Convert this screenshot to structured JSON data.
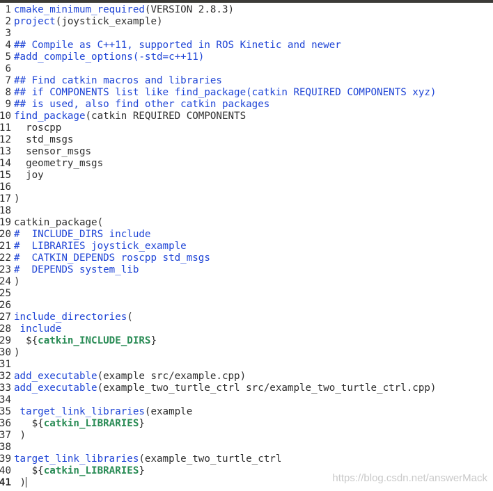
{
  "editor": {
    "watermark": "https://blog.csdn.net/answerMack",
    "colors": {
      "keyword": "#1f45d6",
      "comment": "#1f45d6",
      "variable": "#2a8c56",
      "text": "#2e2e2e",
      "background": "#ffffff"
    },
    "lines": [
      {
        "n": "1",
        "segs": [
          {
            "t": "cmake_minimum_required",
            "c": "kw"
          },
          {
            "t": "(VERSION 2.8.3)",
            "c": ""
          }
        ]
      },
      {
        "n": "2",
        "segs": [
          {
            "t": "project",
            "c": "kw"
          },
          {
            "t": "(joystick_example)",
            "c": ""
          }
        ]
      },
      {
        "n": "3",
        "segs": []
      },
      {
        "n": "4",
        "segs": [
          {
            "t": "## Compile as C++11, supported in ROS Kinetic and newer",
            "c": "cm"
          }
        ]
      },
      {
        "n": "5",
        "segs": [
          {
            "t": "#add_compile_options(-std=c++11)",
            "c": "cm"
          }
        ]
      },
      {
        "n": "6",
        "segs": []
      },
      {
        "n": "7",
        "segs": [
          {
            "t": "## Find catkin macros and libraries",
            "c": "cm"
          }
        ]
      },
      {
        "n": "8",
        "segs": [
          {
            "t": "## if COMPONENTS list like find_package(catkin REQUIRED COMPONENTS xyz)",
            "c": "cm"
          }
        ]
      },
      {
        "n": "9",
        "segs": [
          {
            "t": "## is used, also find other catkin packages",
            "c": "cm"
          }
        ]
      },
      {
        "n": "10",
        "segs": [
          {
            "t": "find_package",
            "c": "kw"
          },
          {
            "t": "(catkin REQUIRED COMPONENTS",
            "c": ""
          }
        ]
      },
      {
        "n": "11",
        "segs": [
          {
            "t": "  roscpp",
            "c": ""
          }
        ]
      },
      {
        "n": "12",
        "segs": [
          {
            "t": "  std_msgs",
            "c": ""
          }
        ]
      },
      {
        "n": "13",
        "segs": [
          {
            "t": "  sensor_msgs",
            "c": ""
          }
        ]
      },
      {
        "n": "14",
        "segs": [
          {
            "t": "  geometry_msgs",
            "c": ""
          }
        ]
      },
      {
        "n": "15",
        "segs": [
          {
            "t": "  joy",
            "c": ""
          }
        ]
      },
      {
        "n": "16",
        "segs": []
      },
      {
        "n": "17",
        "segs": [
          {
            "t": ")",
            "c": ""
          }
        ]
      },
      {
        "n": "18",
        "segs": []
      },
      {
        "n": "19",
        "segs": [
          {
            "t": "catkin_package(",
            "c": ""
          }
        ]
      },
      {
        "n": "20",
        "segs": [
          {
            "t": "#  INCLUDE_DIRS include",
            "c": "cm"
          }
        ]
      },
      {
        "n": "21",
        "segs": [
          {
            "t": "#  LIBRARIES joystick_example",
            "c": "cm"
          }
        ]
      },
      {
        "n": "22",
        "segs": [
          {
            "t": "#  CATKIN_DEPENDS roscpp std_msgs",
            "c": "cm"
          }
        ]
      },
      {
        "n": "23",
        "segs": [
          {
            "t": "#  DEPENDS system_lib",
            "c": "cm"
          }
        ]
      },
      {
        "n": "24",
        "segs": [
          {
            "t": ")",
            "c": ""
          }
        ]
      },
      {
        "n": "25",
        "segs": []
      },
      {
        "n": "26",
        "segs": []
      },
      {
        "n": "27",
        "segs": [
          {
            "t": "include_directories",
            "c": "kw"
          },
          {
            "t": "(",
            "c": ""
          }
        ]
      },
      {
        "n": "28",
        "segs": [
          {
            "t": " include",
            "c": "kw"
          }
        ]
      },
      {
        "n": "29",
        "segs": [
          {
            "t": "  ${",
            "c": ""
          },
          {
            "t": "catkin_INCLUDE_DIRS",
            "c": "vr"
          },
          {
            "t": "}",
            "c": ""
          }
        ]
      },
      {
        "n": "30",
        "segs": [
          {
            "t": ")",
            "c": ""
          }
        ]
      },
      {
        "n": "31",
        "segs": []
      },
      {
        "n": "32",
        "segs": [
          {
            "t": "add_executable",
            "c": "kw"
          },
          {
            "t": "(example src/example.cpp)",
            "c": ""
          }
        ]
      },
      {
        "n": "33",
        "segs": [
          {
            "t": "add_executable",
            "c": "kw"
          },
          {
            "t": "(example_two_turtle_ctrl src/example_two_turtle_ctrl.cpp)",
            "c": ""
          }
        ]
      },
      {
        "n": "34",
        "segs": []
      },
      {
        "n": "35",
        "segs": [
          {
            "t": " target_link_libraries",
            "c": "kw"
          },
          {
            "t": "(example",
            "c": ""
          }
        ]
      },
      {
        "n": "36",
        "segs": [
          {
            "t": "   ${",
            "c": ""
          },
          {
            "t": "catkin_LIBRARIES",
            "c": "vr"
          },
          {
            "t": "}",
            "c": ""
          }
        ]
      },
      {
        "n": "37",
        "segs": [
          {
            "t": " )",
            "c": ""
          }
        ]
      },
      {
        "n": "38",
        "segs": []
      },
      {
        "n": "39",
        "segs": [
          {
            "t": "target_link_libraries",
            "c": "kw"
          },
          {
            "t": "(example_two_turtle_ctrl",
            "c": ""
          }
        ]
      },
      {
        "n": "40",
        "segs": [
          {
            "t": "   ${",
            "c": ""
          },
          {
            "t": "catkin_LIBRARIES",
            "c": "vr"
          },
          {
            "t": "}",
            "c": ""
          }
        ]
      },
      {
        "n": "41",
        "segs": [
          {
            "t": " )",
            "c": ""
          }
        ],
        "cursor": true
      }
    ]
  }
}
